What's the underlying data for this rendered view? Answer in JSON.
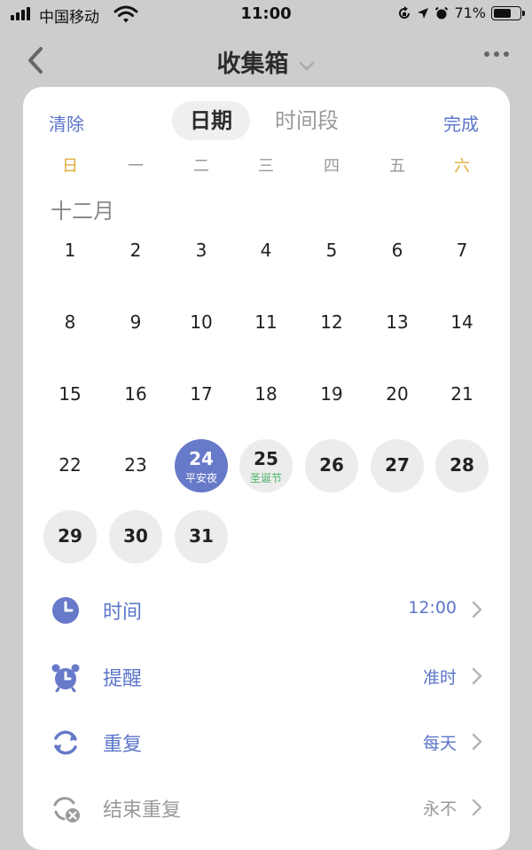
{
  "status_bar": {
    "carrier": "中国移动",
    "time": "11:00",
    "battery": "71%",
    "battery_level": 0.71
  },
  "nav": {
    "title": "收集箱"
  },
  "picker": {
    "clear_label": "清除",
    "done_label": "完成",
    "tabs": [
      "日期",
      "时间段"
    ],
    "active_tab": "日期",
    "weekdays": [
      "日",
      "一",
      "二",
      "三",
      "四",
      "五",
      "六"
    ],
    "weekend_color": "#e2ab3a",
    "month_label": "十二月",
    "days": [
      {
        "n": "1"
      },
      {
        "n": "2"
      },
      {
        "n": "3"
      },
      {
        "n": "4"
      },
      {
        "n": "5"
      },
      {
        "n": "6"
      },
      {
        "n": "7"
      },
      {
        "n": "8"
      },
      {
        "n": "9"
      },
      {
        "n": "10"
      },
      {
        "n": "11"
      },
      {
        "n": "12"
      },
      {
        "n": "13"
      },
      {
        "n": "14"
      },
      {
        "n": "15"
      },
      {
        "n": "16"
      },
      {
        "n": "17"
      },
      {
        "n": "18"
      },
      {
        "n": "19"
      },
      {
        "n": "20"
      },
      {
        "n": "21"
      },
      {
        "n": "22"
      },
      {
        "n": "23"
      },
      {
        "n": "24",
        "sub": "平安夜",
        "state": "selected"
      },
      {
        "n": "25",
        "sub": "圣诞节",
        "state": "holiday"
      },
      {
        "n": "26",
        "state": "upcoming"
      },
      {
        "n": "27",
        "state": "upcoming"
      },
      {
        "n": "28",
        "state": "upcoming"
      },
      {
        "n": "29",
        "state": "upcoming"
      },
      {
        "n": "30",
        "state": "upcoming"
      },
      {
        "n": "31",
        "state": "upcoming"
      }
    ],
    "selected_color": "#6779c9",
    "holiday_color": "#4cb46a"
  },
  "options": [
    {
      "label": "时间",
      "value": "12:00",
      "icon": "clock-icon"
    },
    {
      "label": "提醒",
      "value": "准时",
      "icon": "alarm-icon"
    },
    {
      "label": "重复",
      "value": "每天",
      "icon": "repeat-icon"
    },
    {
      "label": "结束重复",
      "value": "永不",
      "icon": "end-repeat-icon",
      "dimmed": true
    }
  ],
  "accent_color": "#5b75c9"
}
